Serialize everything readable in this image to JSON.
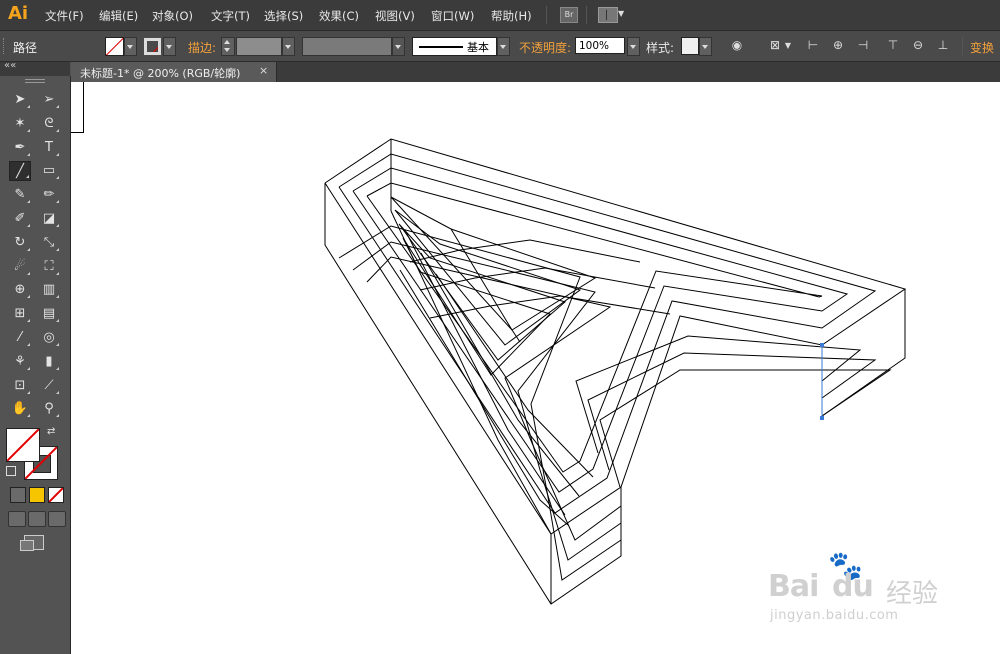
{
  "app": {
    "logo": "Ai"
  },
  "menu": [
    {
      "label": "文件(F)"
    },
    {
      "label": "编辑(E)"
    },
    {
      "label": "对象(O)"
    },
    {
      "label": "文字(T)"
    },
    {
      "label": "选择(S)"
    },
    {
      "label": "效果(C)"
    },
    {
      "label": "视图(V)"
    },
    {
      "label": "窗口(W)"
    },
    {
      "label": "帮助(H)"
    }
  ],
  "menubar_icons": {
    "bridge": "Br",
    "workspace": "workspace-switcher-icon"
  },
  "control": {
    "selection_label": "路径",
    "stroke_label": "描边:",
    "stroke_profile": "基本",
    "opacity_label": "不透明度:",
    "opacity_value": "100%",
    "style_label": "样式:",
    "transform_label": "变换"
  },
  "document": {
    "tab_title": "未标题-1* @ 200% (RGB/轮廓)",
    "close_glyph": "×"
  },
  "colors": {
    "accent": "#f7a41d",
    "panel": "#535353",
    "menubar": "#3b3b3b",
    "canvas": "#ffffff",
    "none_slash": "#e00000",
    "anchor": "#3a7bd5"
  },
  "tools": [
    {
      "name": "selection-tool-icon",
      "glyph": "➤"
    },
    {
      "name": "direct-selection-tool-icon",
      "glyph": "➢"
    },
    {
      "name": "magic-wand-tool-icon",
      "glyph": "✶"
    },
    {
      "name": "lasso-tool-icon",
      "glyph": "ᘓ"
    },
    {
      "name": "pen-tool-icon",
      "glyph": "✒"
    },
    {
      "name": "type-tool-icon",
      "glyph": "T"
    },
    {
      "name": "line-segment-tool-icon",
      "glyph": "╱"
    },
    {
      "name": "rectangle-tool-icon",
      "glyph": "▭"
    },
    {
      "name": "paintbrush-tool-icon",
      "glyph": "✎"
    },
    {
      "name": "pencil-tool-icon",
      "glyph": "✏"
    },
    {
      "name": "blob-brush-tool-icon",
      "glyph": "✐"
    },
    {
      "name": "eraser-tool-icon",
      "glyph": "◪"
    },
    {
      "name": "rotate-tool-icon",
      "glyph": "↻"
    },
    {
      "name": "scale-tool-icon",
      "glyph": "⤡"
    },
    {
      "name": "warp-tool-icon",
      "glyph": "☄"
    },
    {
      "name": "free-transform-tool-icon",
      "glyph": "⛶"
    },
    {
      "name": "shape-builder-tool-icon",
      "glyph": "⊕"
    },
    {
      "name": "perspective-grid-tool-icon",
      "glyph": "▥"
    },
    {
      "name": "mesh-tool-icon",
      "glyph": "⊞"
    },
    {
      "name": "gradient-tool-icon",
      "glyph": "▤"
    },
    {
      "name": "eyedropper-tool-icon",
      "glyph": "⁄"
    },
    {
      "name": "blend-tool-icon",
      "glyph": "◎"
    },
    {
      "name": "symbol-sprayer-tool-icon",
      "glyph": "⚘"
    },
    {
      "name": "column-graph-tool-icon",
      "glyph": "▮"
    },
    {
      "name": "artboard-tool-icon",
      "glyph": "⊡"
    },
    {
      "name": "slice-tool-icon",
      "glyph": "⟋"
    },
    {
      "name": "hand-tool-icon",
      "glyph": "✋"
    },
    {
      "name": "zoom-tool-icon",
      "glyph": "⚲"
    }
  ],
  "watermark": {
    "brand": "Bai",
    "du": "du",
    "cn": "经验",
    "url": "jingyan.baidu.com"
  }
}
